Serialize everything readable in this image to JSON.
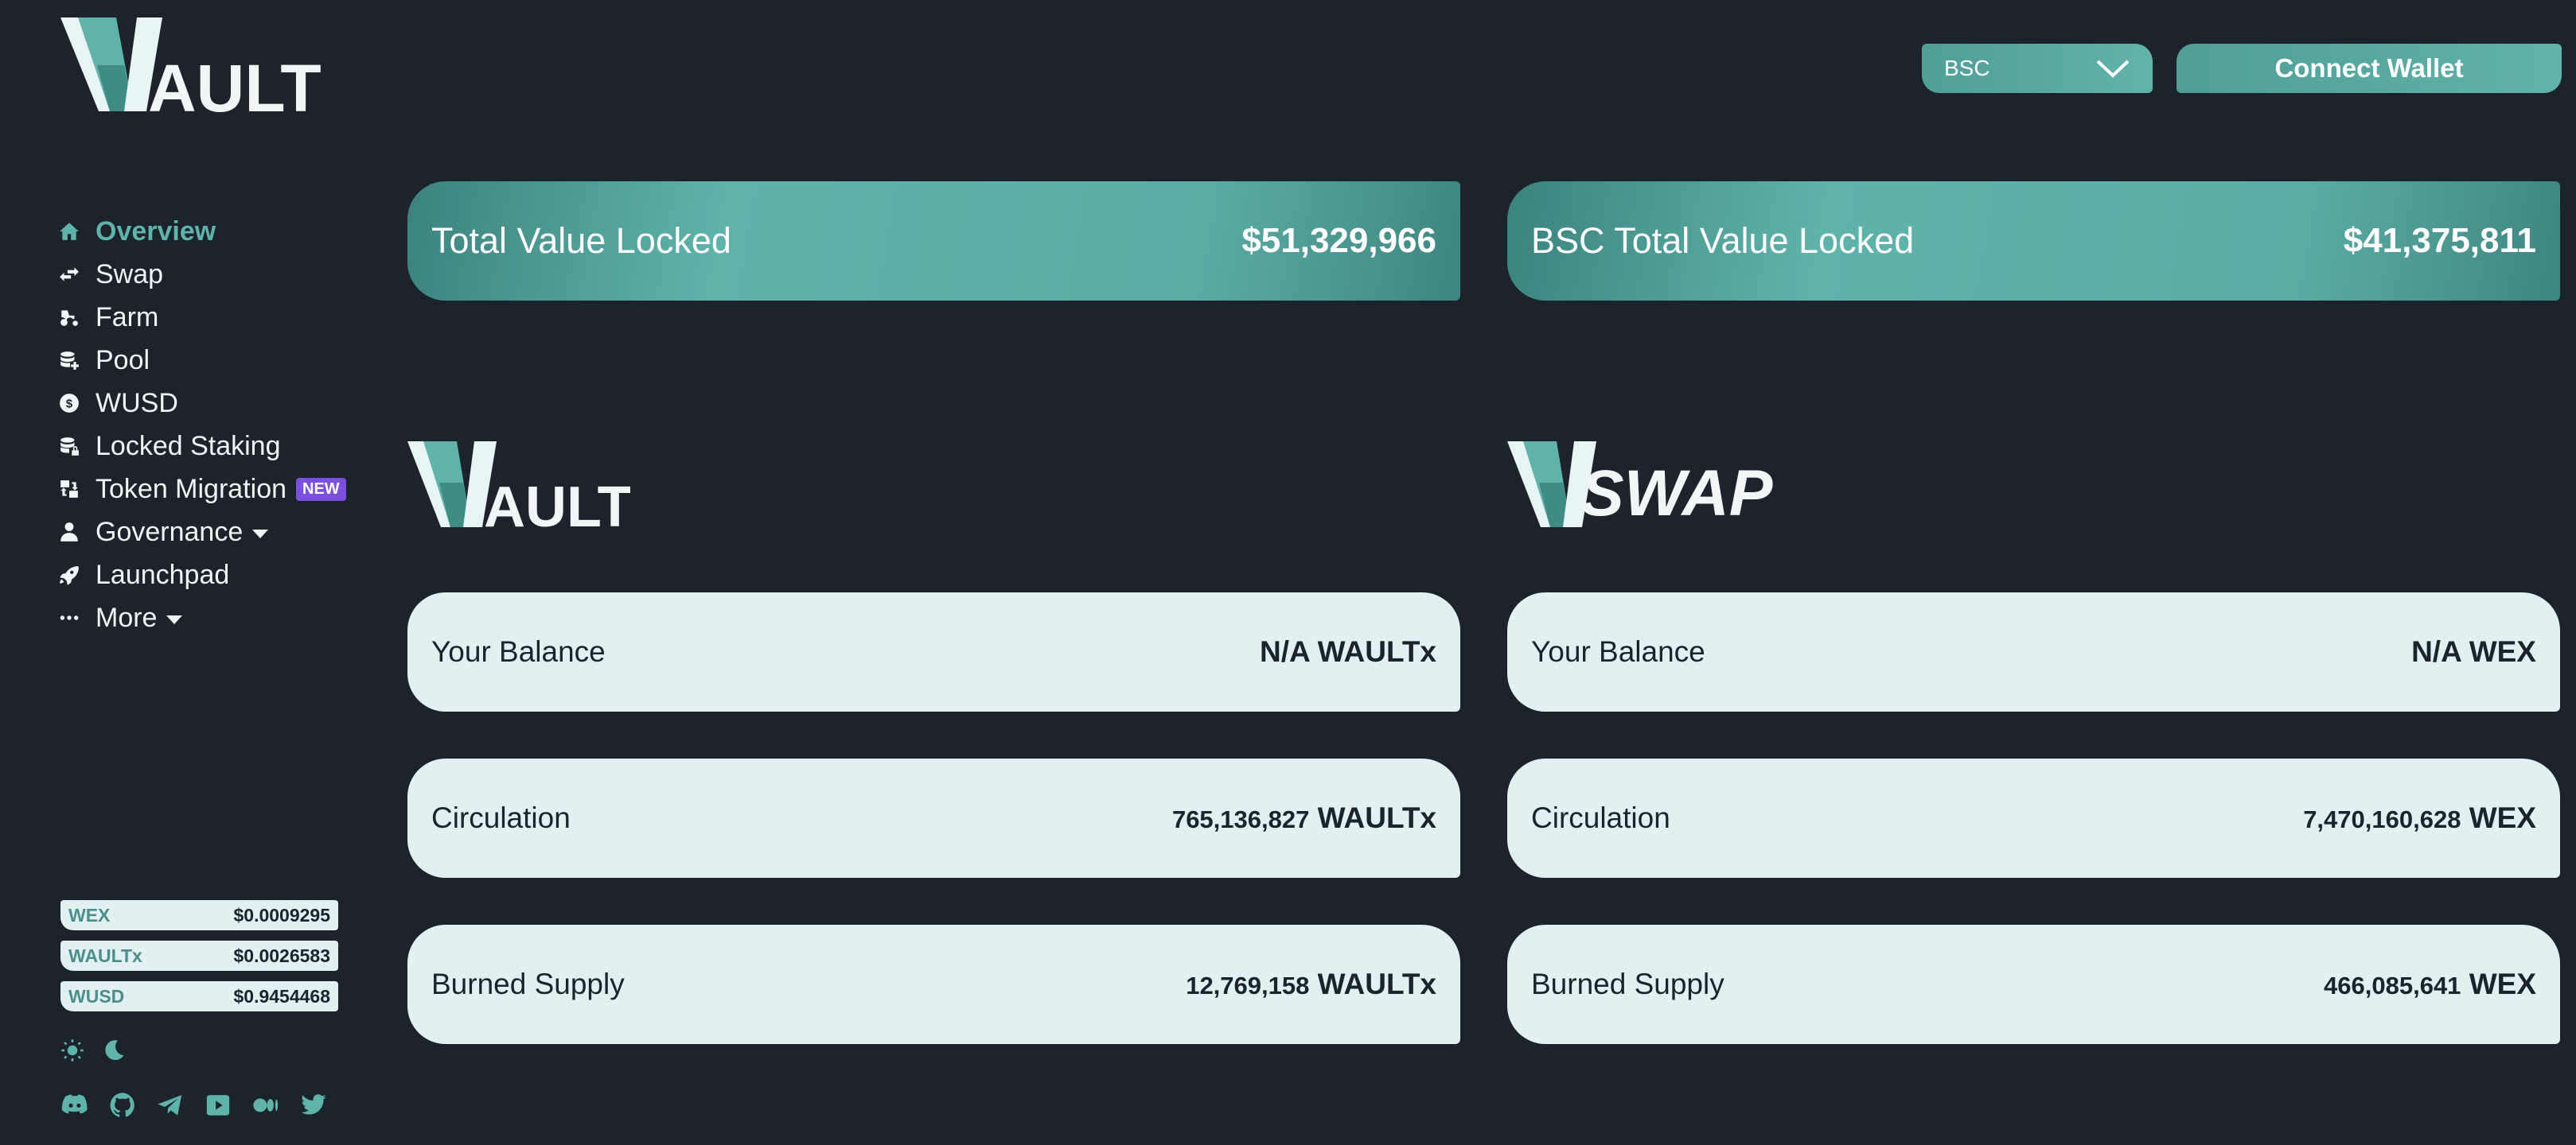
{
  "app": {
    "logo_text": "WAULT"
  },
  "sidebar": {
    "items": [
      {
        "label": "Overview",
        "icon": "home-icon",
        "active": true
      },
      {
        "label": "Swap",
        "icon": "swap-icon"
      },
      {
        "label": "Farm",
        "icon": "tractor-icon"
      },
      {
        "label": "Pool",
        "icon": "database-plus-icon"
      },
      {
        "label": "WUSD",
        "icon": "dollar-coin-icon"
      },
      {
        "label": "Locked Staking",
        "icon": "database-lock-icon"
      },
      {
        "label": "Token Migration",
        "icon": "migration-icon",
        "badge": "NEW"
      },
      {
        "label": "Governance",
        "icon": "user-tie-icon",
        "dropdown": true
      },
      {
        "label": "Launchpad",
        "icon": "rocket-icon"
      },
      {
        "label": "More",
        "icon": "ellipsis-icon",
        "dropdown": true
      }
    ],
    "prices": [
      {
        "token": "WEX",
        "price": "$0.0009295"
      },
      {
        "token": "WAULTx",
        "price": "$0.0026583"
      },
      {
        "token": "WUSD",
        "price": "$0.9454468"
      }
    ],
    "theme_icons": [
      "sun-icon",
      "moon-icon"
    ],
    "social_icons": [
      "discord-icon",
      "github-icon",
      "telegram-icon",
      "youtube-icon",
      "medium-icon",
      "twitter-icon"
    ]
  },
  "header": {
    "chain_selected": "BSC",
    "connect_label": "Connect Wallet"
  },
  "tvl": {
    "total_label": "Total Value Locked",
    "total_value": "$51,329,966",
    "bsc_label": "BSC Total Value Locked",
    "bsc_value": "$41,375,811"
  },
  "wault": {
    "logo_text": "WAULT",
    "balance_label": "Your Balance",
    "balance_value": "N/A WAULTx",
    "circulation_label": "Circulation",
    "circulation_num": "765,136,827",
    "circulation_unit": "WAULTx",
    "burned_label": "Burned Supply",
    "burned_num": "12,769,158",
    "burned_unit": "WAULTx"
  },
  "wswap": {
    "logo_text": "WSWAP",
    "balance_label": "Your Balance",
    "balance_value": "N/A WEX",
    "circulation_label": "Circulation",
    "circulation_num": "7,470,160,628",
    "circulation_unit": "WEX",
    "burned_label": "Burned Supply",
    "burned_num": "466,085,641",
    "burned_unit": "WEX"
  },
  "colors": {
    "background": "#1a242a",
    "accent": "#5fb3ab",
    "card_light": "#e3f0f2",
    "badge": "#7b4fe0"
  }
}
